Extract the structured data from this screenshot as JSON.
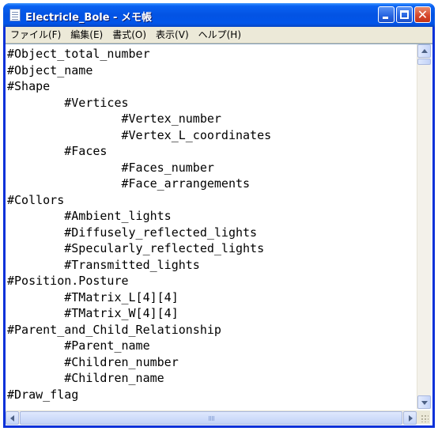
{
  "window": {
    "title": "Electricle_Bole - メモ帳",
    "icon": "notepad-icon"
  },
  "menu": [
    "ファイル(F)",
    "編集(E)",
    "書式(O)",
    "表示(V)",
    "ヘルプ(H)"
  ],
  "lines": [
    "#Object_total_number",
    "#Object_name",
    "#Shape",
    "        #Vertices",
    "                #Vertex_number",
    "                #Vertex_L_coordinates",
    "        #Faces",
    "                #Faces_number",
    "                #Face_arrangements",
    "#Collors",
    "        #Ambient_lights",
    "        #Diffusely_reflected_lights",
    "        #Specularly_reflected_lights",
    "        #Transmitted_lights",
    "#Position.Posture",
    "        #TMatrix_L[4][4]",
    "        #TMatrix_W[4][4]",
    "#Parent_and_Child_Relationship",
    "        #Parent_name",
    "        #Children_number",
    "        #Children_name",
    "#Draw_flag"
  ]
}
